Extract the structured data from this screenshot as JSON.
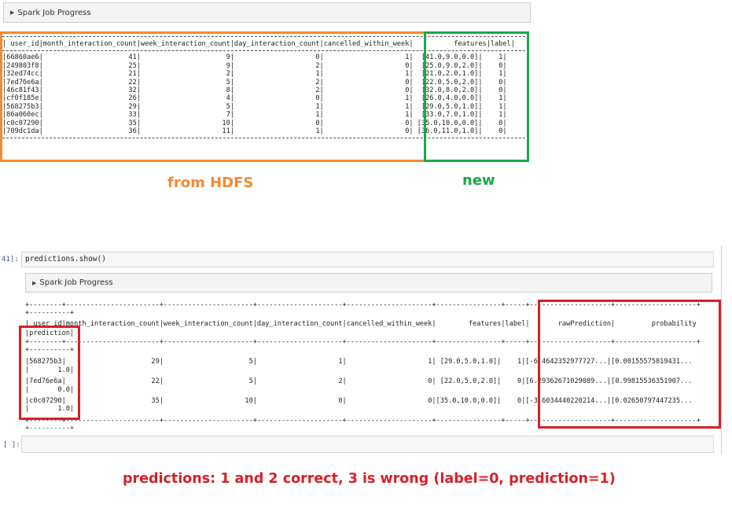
{
  "top_progress": {
    "label": "Spark Job Progress"
  },
  "top_table": {
    "header": "| user_id|month_interaction_count|week_interaction_count|day_interaction_count|cancelled_within_week|          features|label|",
    "rows": [
      "|66860ae6|                     41|                     9|                    0|                    1|  [41.0,9.0,0.0]|    1|",
      "|249803f8|                     25|                     9|                    2|                    0|  [25.0,9.0,2.0]|    0|",
      "|32ed74cc|                     21|                     2|                    1|                    1|  [21.0,2.0,1.0]|    1|",
      "|7ed76e6a|                     22|                     5|                    2|                    0|  [22.0,5.0,2.0]|    0|",
      "|46c81f43|                     32|                     8|                    2|                    0|  [32.0,8.0,2.0]|    0|",
      "|cf0f185e|                     26|                     4|                    0|                    1|  [26.0,4.0,0.0]|    1|",
      "|568275b3|                     29|                     5|                    1|                    1|  [29.0,5.0,1.0]|    1|",
      "|86a060ec|                     33|                     7|                    1|                    1|  [33.0,7.0,1.0]|    1|",
      "|c0c07290|                     35|                    10|                    0|                    0| [35.0,10.0,0.0]|    0|",
      "|709dc1da|                     36|                    11|                    1|                    0| [36.0,11.0,1.0]|    0|"
    ]
  },
  "labels": {
    "from_hdfs": "from HDFS",
    "new": "new"
  },
  "cell": {
    "prompt": "41]:",
    "code": "predictions.show()"
  },
  "bottom_progress": {
    "label": "Spark Job Progress"
  },
  "bottom_table": {
    "sep1": "+--------+-----------------------+----------------------+---------------------+---------------------+----------------+-----+--------------------+--------------------+",
    "sep2": "+----------+",
    "header": "| user_id|month_interaction_count|week_interaction_count|day_interaction_count|cancelled_within_week|        features|label|       rawPrediction|         probability",
    "header2": "|prediction|",
    "rows": [
      {
        "main": "|568275b3|                     29|                     5|                    1|                    1| [29.0,5.0,1.0]|    1|[-6.4642352977727...|[0.00155575819431...",
        "pred": "|       1.0|"
      },
      {
        "main": "|7ed76e6a|                     22|                     5|                    2|                    0| [22.0,5.0,2.0]|    0|[6.29362671029089...|[0.99815536351907...",
        "pred": "|       0.0|"
      },
      {
        "main": "|c0c07290|                     35|                    10|                    0|                    0|[35.0,10.0,0.0]|    0|[-3.6034440220214...|[0.02650797447235...",
        "pred": "|       1.0|"
      }
    ]
  },
  "empty_prompt": "[ ]:",
  "caption": "predictions: 1 and 2 correct, 3 is wrong (label=0, prediction=1)",
  "colors": {
    "orange": "#f58a2f",
    "green": "#1aa84b",
    "red": "#d81f26"
  }
}
